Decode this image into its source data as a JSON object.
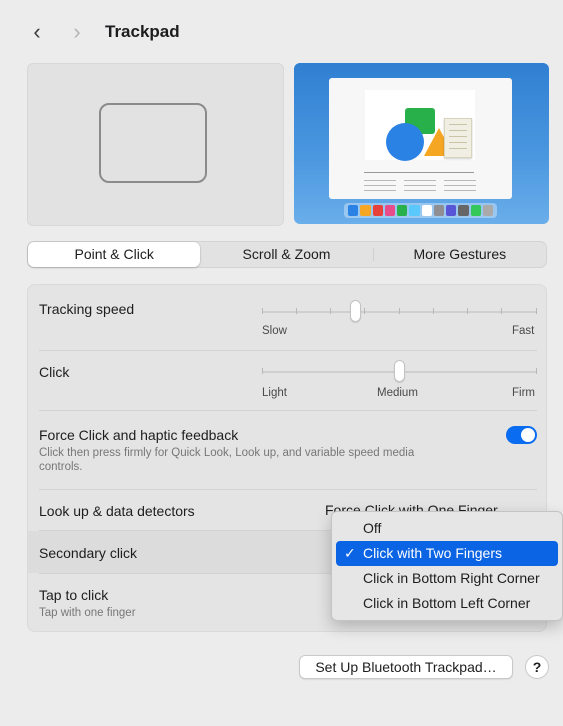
{
  "header": {
    "title": "Trackpad"
  },
  "tabs": [
    "Point & Click",
    "Scroll & Zoom",
    "More Gestures"
  ],
  "settings": {
    "tracking_speed": {
      "label": "Tracking speed",
      "min_label": "Slow",
      "max_label": "Fast",
      "value": 0.33
    },
    "click": {
      "label": "Click",
      "labels": [
        "Light",
        "Medium",
        "Firm"
      ],
      "value": 0.5
    },
    "force_click": {
      "label": "Force Click and haptic feedback",
      "description": "Click then press firmly for Quick Look, Look up, and variable speed media controls.",
      "enabled": true
    },
    "look_up": {
      "label": "Look up & data detectors",
      "value": "Force Click with One Finger"
    },
    "secondary_click": {
      "label": "Secondary click"
    },
    "tap_to_click": {
      "label": "Tap to click",
      "description": "Tap with one finger"
    }
  },
  "secondary_click_menu": {
    "options": [
      "Off",
      "Click with Two Fingers",
      "Click in Bottom Right Corner",
      "Click in Bottom Left Corner"
    ],
    "selected": "Click with Two Fingers",
    "check": "✓"
  },
  "footer": {
    "setup_button": "Set Up Bluetooth Trackpad…",
    "help": "?"
  },
  "colors": {
    "accent": "#0a64e4"
  }
}
